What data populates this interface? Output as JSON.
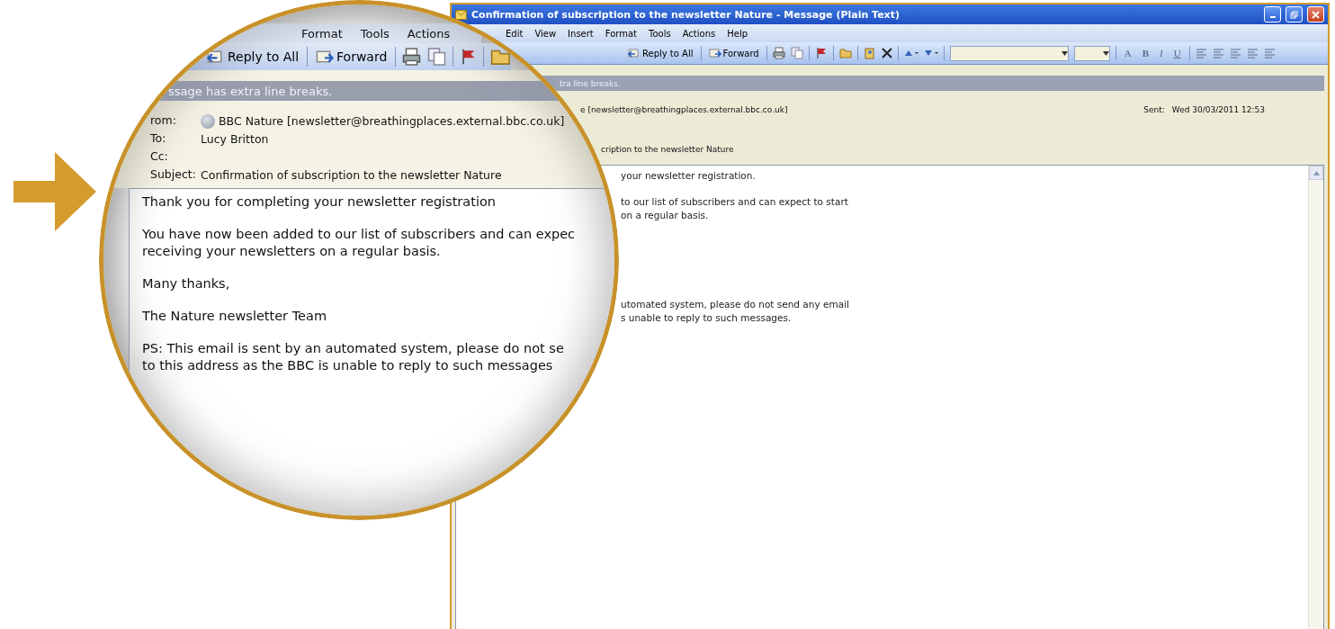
{
  "window": {
    "title": "Confirmation of subscription to the newsletter Nature - Message (Plain Text)",
    "menu": [
      "Edit",
      "View",
      "Insert",
      "Format",
      "Tools",
      "Actions",
      "Help"
    ],
    "toolbar": [
      "Reply to All",
      "Forward"
    ],
    "format_buttons": [
      "A",
      "B",
      "I",
      "U"
    ],
    "info_bar": "tra line breaks.",
    "from": "e [newsletter@breathingplaces.external.bbc.co.uk]",
    "sent": {
      "label": "Sent:",
      "value": "Wed 30/03/2011 12:53"
    },
    "subject": "cription to the newsletter Nature",
    "body": [
      [
        "your newsletter registration."
      ],
      [
        "to our list of subscribers and can expect to start",
        "on a regular basis."
      ],
      [
        "utomated system, please do not send any email",
        "s unable to reply to such messages."
      ]
    ]
  },
  "magnifier": {
    "menu": [
      "Format",
      "Tools",
      "Actions"
    ],
    "toolbar": [
      "Reply to All",
      "Forward"
    ],
    "info_bar": "ssage has extra line breaks.",
    "fields": [
      {
        "label": "rom:",
        "value": "BBC Nature [newsletter@breathingplaces.external.bbc.co.uk]",
        "avatar": true
      },
      {
        "label": "To:",
        "value": "Lucy Britton",
        "avatar": false
      },
      {
        "label": "Cc:",
        "avatar": false
      },
      {
        "label": "Subject:",
        "value": "Confirmation of subscription to the newsletter Nature",
        "avatar": false
      }
    ],
    "body": [
      [
        "Thank you for completing your newsletter registration"
      ],
      [
        "You have now been added to our list of subscribers and can expec",
        "receiving your newsletters on a regular basis."
      ],
      [
        "Many thanks,"
      ],
      [
        "The Nature newsletter Team"
      ],
      [
        "PS: This email is sent by an automated system, please do not se",
        "to this address as the BBC is unable to reply to such messages"
      ]
    ]
  }
}
